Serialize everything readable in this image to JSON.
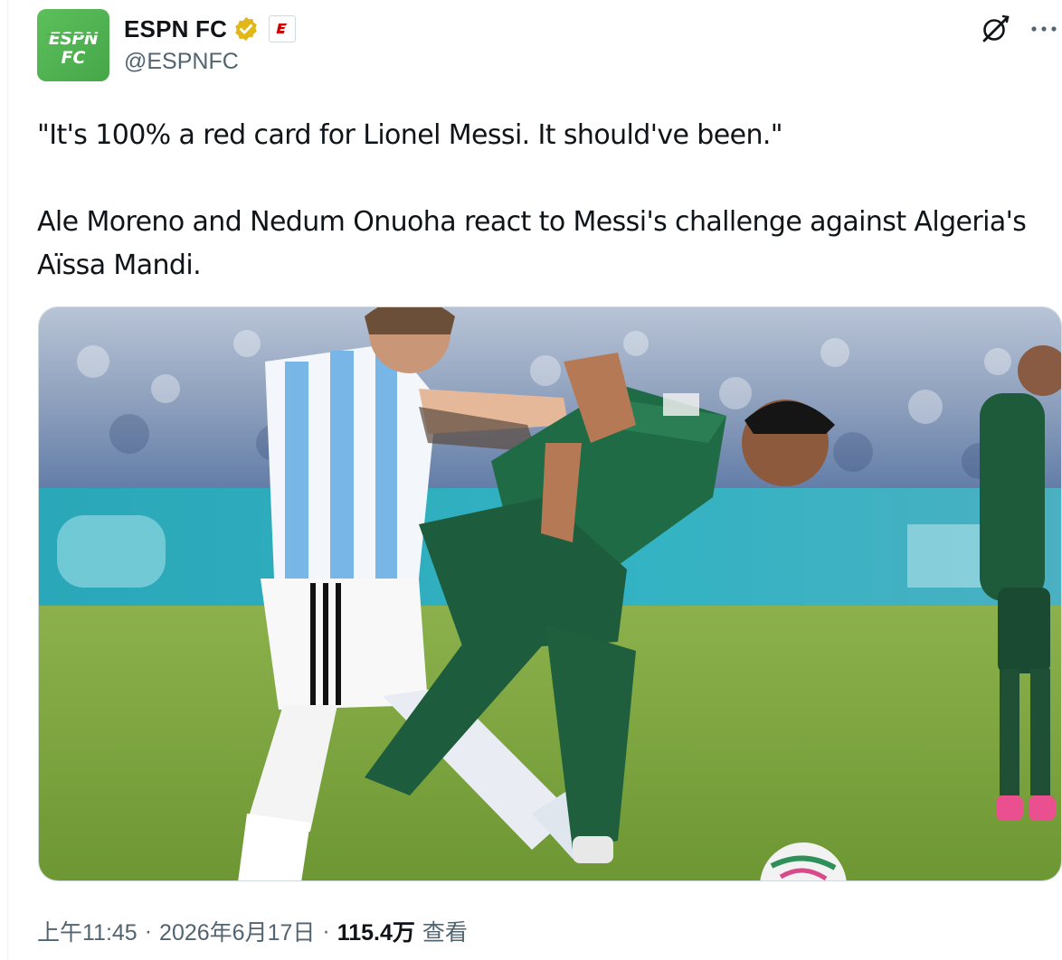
{
  "tweet": {
    "author": {
      "display_name": "ESPN FC",
      "handle": "@ESPNFC",
      "verified": true,
      "verified_color": "#e2b719",
      "affiliate_badge": "espn-e-logo",
      "avatar_lines": [
        "ESPN",
        "FC"
      ],
      "avatar_color": "#4caf50"
    },
    "text": "\"It's 100% a red card for Lionel Messi. It should've been.\"\n\nAle Moreno and Nedum Onuoha react to Messi's challenge against Algeria's Aïssa Mandi.",
    "media": {
      "type": "photo"
    },
    "meta": {
      "time": "上午11:45",
      "date": "2026年6月17日",
      "separator": "·",
      "views_count": "115.4万",
      "views_label": "查看"
    },
    "actions": {
      "grok_icon": "grok-icon",
      "more_icon": "more-icon"
    }
  }
}
